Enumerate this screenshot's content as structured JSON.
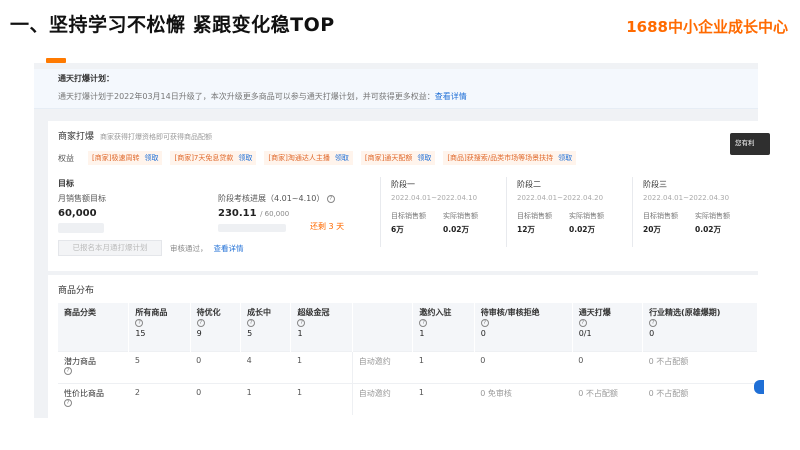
{
  "slide": {
    "title": "一、坚持学习不松懈   紧跟变化稳TOP",
    "brand_num": "1688",
    "brand_text": "中小企业成长中心"
  },
  "notice": {
    "title": "通天打爆计划：",
    "text": "通天打爆计划于2022年03月14日升级了，本次升级更多商品可以参与通天打爆计划，并可获得更多权益：",
    "link": "查看详情"
  },
  "merchant": {
    "title": "商家打爆",
    "subtitle": "商家获得打爆资格即可获得商品配额",
    "rights_label": "权益",
    "claim_label": "领取",
    "rights": [
      "[商家]极速周转",
      "[商家]7天免息贷款",
      "[商家]淘通达人主播",
      "[商家]通天配额",
      "[商品]获搜索/品类市场等场景扶持"
    ],
    "goal_label": "目标",
    "monthly_target_label": "月销售额目标",
    "monthly_target_value": "60,000",
    "progress_label": "阶段考核进展（4.01~4.10）",
    "progress_value": "230.11",
    "progress_total": "/ 60,000",
    "progress_fraction": 0.004,
    "remaining": "还剩 3 天",
    "apply_button": "已报名本月通打爆计划",
    "review_text": "审核通过，",
    "review_link": "查看详情"
  },
  "stages": [
    {
      "name": "阶段一",
      "dates": "2022.04.01~2022.04.10",
      "target_label": "目标销售额",
      "actual_label": "实际销售额",
      "target": "6万",
      "actual": "0.02万"
    },
    {
      "name": "阶段二",
      "dates": "2022.04.01~2022.04.20",
      "target_label": "目标销售额",
      "actual_label": "实际销售额",
      "target": "12万",
      "actual": "0.02万"
    },
    {
      "name": "阶段三",
      "dates": "2022.04.01~2022.04.30",
      "target_label": "目标销售额",
      "actual_label": "实际销售额",
      "target": "20万",
      "actual": "0.02万"
    }
  ],
  "tooltip": "您有利",
  "distribution": {
    "title": "商品分布",
    "headers": [
      {
        "label": "商品分类",
        "count": ""
      },
      {
        "label": "所有商品",
        "count": "15"
      },
      {
        "label": "待优化",
        "count": "9"
      },
      {
        "label": "成长中",
        "count": "5"
      },
      {
        "label": "超级金冠",
        "count": "1"
      },
      {
        "label": "",
        "count": ""
      },
      {
        "label": "邀约入驻",
        "count": "1"
      },
      {
        "label": "待审核/审核拒绝",
        "count": "0"
      },
      {
        "label": "通天打爆",
        "count": "0/1"
      },
      {
        "label": "行业精选(原雄爆期)",
        "count": "0"
      }
    ],
    "rows": [
      {
        "name": "潜力商品",
        "cells": [
          "5",
          "0",
          "4",
          "1",
          "自动邀约",
          "1",
          "0",
          "0",
          "0 不占配额"
        ]
      },
      {
        "name": "性价比商品",
        "cells": [
          "2",
          "0",
          "1",
          "1",
          "自动邀约",
          "1",
          "0 免审核",
          "0 不占配额",
          "0 不占配额"
        ]
      }
    ]
  }
}
